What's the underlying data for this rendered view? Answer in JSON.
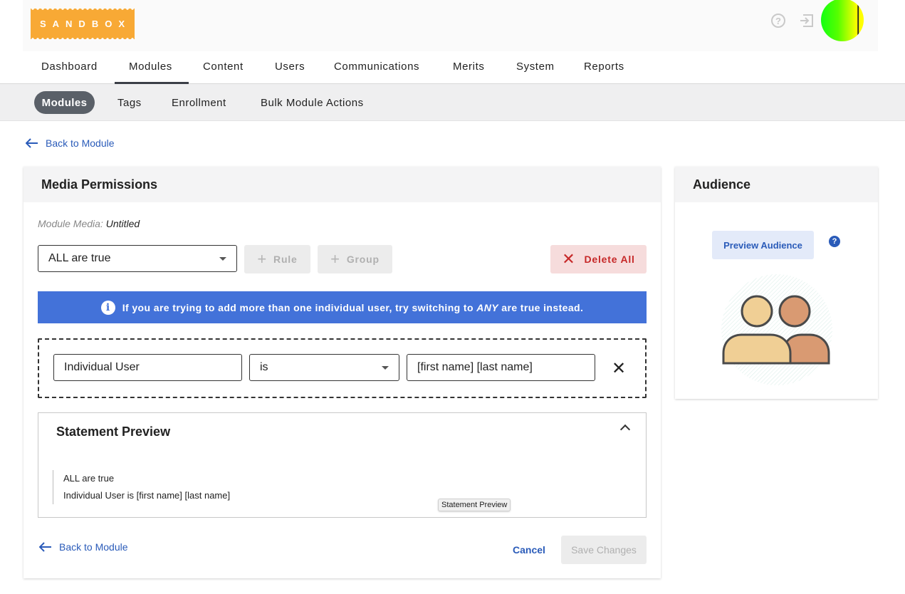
{
  "header": {
    "logo_text": "SANDBOX",
    "help_glyph": "?",
    "icons": [
      "help-circle-icon",
      "logout-icon",
      "avatar"
    ]
  },
  "main_nav": {
    "items": [
      "Dashboard",
      "Modules",
      "Content",
      "Users",
      "Communications",
      "Merits",
      "System",
      "Reports"
    ],
    "active": "Modules"
  },
  "sub_nav": {
    "items": [
      "Modules",
      "Tags",
      "Enrollment",
      "Bulk Module Actions"
    ],
    "active": "Modules"
  },
  "back_link_top": "Back to Module",
  "permissions": {
    "title": "Media Permissions",
    "media_label": "Module Media:",
    "media_value": "Untitled",
    "match_select": "ALL are true",
    "add_rule_label": "Rule",
    "add_group_label": "Group",
    "delete_all_label": "Delete All",
    "banner": {
      "prefix": "If you are trying to add more than one individual user, try switching to",
      "emphasis": "ANY",
      "suffix": "are true instead."
    },
    "rule": {
      "field": "Individual User",
      "operator": "is",
      "value": "[first name] [last name]"
    },
    "preview": {
      "title": "Statement Preview",
      "lines": [
        "ALL are true",
        "Individual User is [first name] [last name]"
      ],
      "tooltip": "Statement Preview"
    },
    "footer": {
      "back_label": "Back to Module",
      "cancel_label": "Cancel",
      "save_label": "Save Changes"
    }
  },
  "audience": {
    "title": "Audience",
    "preview_button": "Preview Audience",
    "help_glyph": "?"
  },
  "colors": {
    "accent_blue": "#4372d9",
    "link_blue": "#2a5bb9",
    "logo_orange": "#f8a935",
    "danger": "#c62828"
  }
}
